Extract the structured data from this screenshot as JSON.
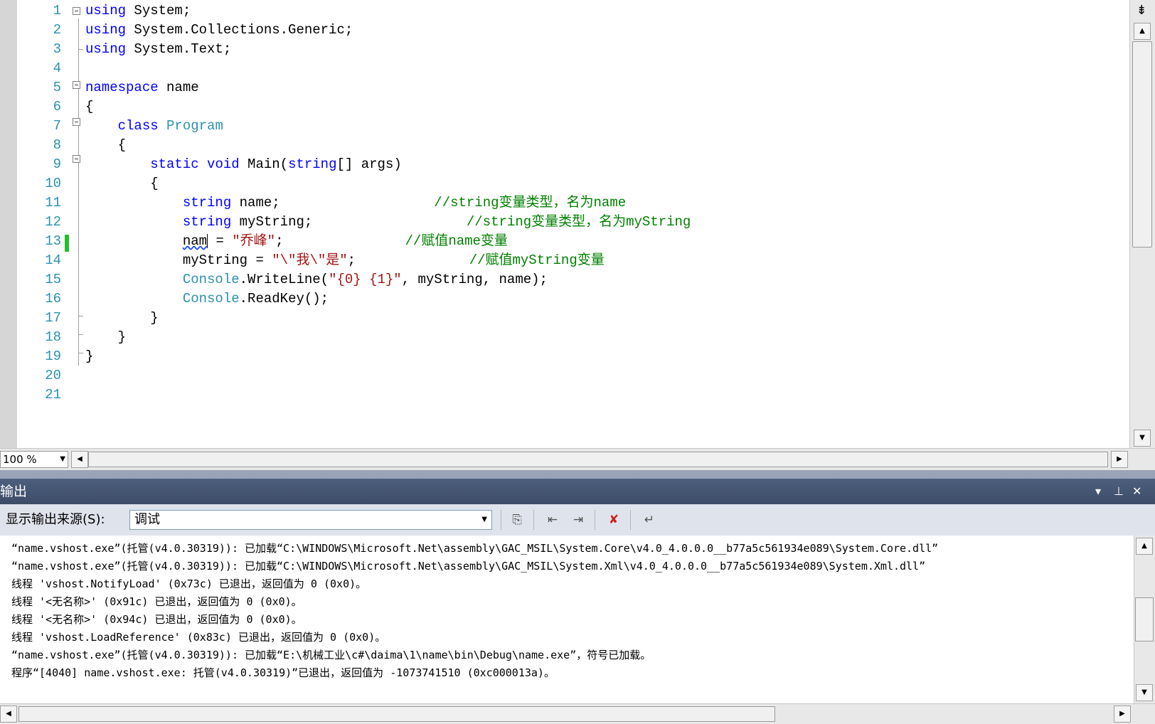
{
  "editor": {
    "zoom": "100 %",
    "line_numbers": [
      "1",
      "2",
      "3",
      "4",
      "5",
      "6",
      "7",
      "8",
      "9",
      "10",
      "11",
      "12",
      "13",
      "14",
      "15",
      "16",
      "17",
      "18",
      "19",
      "20",
      "21"
    ],
    "lines": [
      [
        {
          "t": "using",
          "c": "kw"
        },
        {
          "t": " System;"
        }
      ],
      [
        {
          "t": "using",
          "c": "kw"
        },
        {
          "t": " System.Collections.Generic;"
        }
      ],
      [
        {
          "t": "using",
          "c": "kw"
        },
        {
          "t": " System.Text;"
        }
      ],
      [],
      [
        {
          "t": "namespace",
          "c": "kw"
        },
        {
          "t": " name"
        }
      ],
      [
        {
          "t": "{"
        }
      ],
      [
        {
          "t": "    "
        },
        {
          "t": "class",
          "c": "kw"
        },
        {
          "t": " "
        },
        {
          "t": "Program",
          "c": "ty"
        }
      ],
      [
        {
          "t": "    {"
        }
      ],
      [
        {
          "t": "        "
        },
        {
          "t": "static",
          "c": "kw"
        },
        {
          "t": " "
        },
        {
          "t": "void",
          "c": "kw"
        },
        {
          "t": " Main("
        },
        {
          "t": "string",
          "c": "kw"
        },
        {
          "t": "[] args)"
        }
      ],
      [
        {
          "t": "        {"
        }
      ],
      [
        {
          "t": "            "
        },
        {
          "t": "string",
          "c": "kw"
        },
        {
          "t": " name;                   "
        },
        {
          "t": "//string变量类型，名为name",
          "c": "cm"
        }
      ],
      [
        {
          "t": "            "
        },
        {
          "t": "string",
          "c": "kw"
        },
        {
          "t": " myString;                   "
        },
        {
          "t": "//string变量类型，名为myString",
          "c": "cm"
        }
      ],
      [
        {
          "t": "            "
        },
        {
          "t": "nam",
          "c": "squig"
        },
        {
          "t": "",
          "c": "caret"
        },
        {
          "t": " = "
        },
        {
          "t": "\"乔峰\"",
          "c": "st"
        },
        {
          "t": ";               "
        },
        {
          "t": "//赋值name变量",
          "c": "cm"
        }
      ],
      [
        {
          "t": "            myString = "
        },
        {
          "t": "\"\\\"我\\\"是\"",
          "c": "st"
        },
        {
          "t": ";              "
        },
        {
          "t": "//赋值myString变量",
          "c": "cm"
        }
      ],
      [
        {
          "t": "            "
        },
        {
          "t": "Console",
          "c": "ty"
        },
        {
          "t": ".WriteLine("
        },
        {
          "t": "\"{0} {1}\"",
          "c": "st"
        },
        {
          "t": ", myString, name);"
        }
      ],
      [
        {
          "t": "            "
        },
        {
          "t": "Console",
          "c": "ty"
        },
        {
          "t": ".ReadKey();"
        }
      ],
      [
        {
          "t": "        }"
        }
      ],
      [
        {
          "t": "    }"
        }
      ],
      [
        {
          "t": "}"
        }
      ],
      [],
      []
    ]
  },
  "output": {
    "title": "输出",
    "source_label": "显示输出来源(S):",
    "source_value": "调试",
    "lines": [
      "“name.vshost.exe”(托管(v4.0.30319)): 已加载“C:\\WINDOWS\\Microsoft.Net\\assembly\\GAC_MSIL\\System.Core\\v4.0_4.0.0.0__b77a5c561934e089\\System.Core.dll”",
      "“name.vshost.exe”(托管(v4.0.30319)): 已加载“C:\\WINDOWS\\Microsoft.Net\\assembly\\GAC_MSIL\\System.Xml\\v4.0_4.0.0.0__b77a5c561934e089\\System.Xml.dll”",
      "线程 'vshost.NotifyLoad' (0x73c) 已退出，返回值为 0 (0x0)。",
      "线程 '<无名称>' (0x91c) 已退出，返回值为 0 (0x0)。",
      "线程 '<无名称>' (0x94c) 已退出，返回值为 0 (0x0)。",
      "线程 'vshost.LoadReference' (0x83c) 已退出，返回值为 0 (0x0)。",
      "“name.vshost.exe”(托管(v4.0.30319)): 已加载“E:\\机械工业\\c#\\daima\\1\\name\\bin\\Debug\\name.exe”，符号已加载。",
      "程序“[4040] name.vshost.exe: 托管(v4.0.30319)”已退出，返回值为 -1073741510 (0xc000013a)。"
    ]
  },
  "colors": {
    "keyword": "#0000ff",
    "type": "#2b91af",
    "string": "#a31515",
    "comment": "#008000",
    "line_number": "#2b91af",
    "change_bar": "#22c02e",
    "panel_title": "#3d4d68"
  }
}
